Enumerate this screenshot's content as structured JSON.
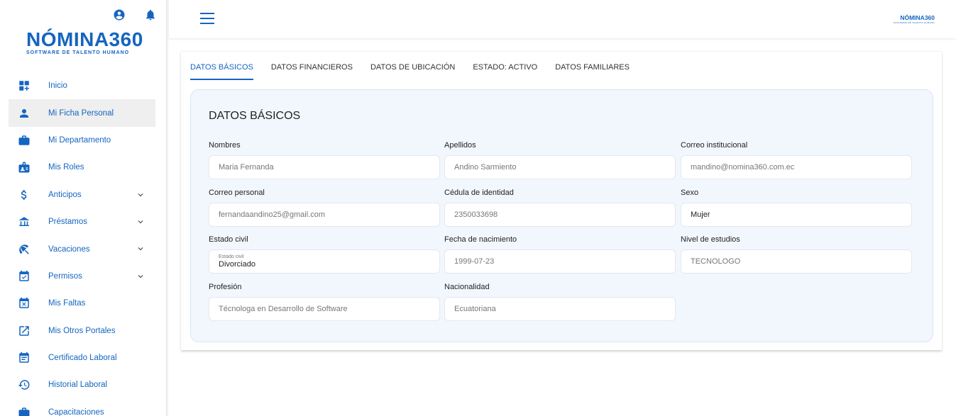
{
  "sidebar": {
    "logo_main": "NÓMINA360",
    "logo_sub": "SOFTWARE DE TALENTO HUMANO",
    "items": [
      {
        "label": "Inicio",
        "icon": "dashboard-icon",
        "expandable": false
      },
      {
        "label": "Mi Ficha Personal",
        "icon": "person-icon",
        "expandable": false,
        "active": true
      },
      {
        "label": "Mi Departamento",
        "icon": "briefcase-icon",
        "expandable": false
      },
      {
        "label": "Mis Roles",
        "icon": "badge-icon",
        "expandable": false
      },
      {
        "label": "Anticipos",
        "icon": "dollar-icon",
        "expandable": true
      },
      {
        "label": "Préstamos",
        "icon": "loan-icon",
        "expandable": true
      },
      {
        "label": "Vacaciones",
        "icon": "beach-icon",
        "expandable": true
      },
      {
        "label": "Permisos",
        "icon": "calendar-check-icon",
        "expandable": true
      },
      {
        "label": "Mis Faltas",
        "icon": "calendar-x-icon",
        "expandable": false
      },
      {
        "label": "Mis Otros Portales",
        "icon": "external-link-icon",
        "expandable": false
      },
      {
        "label": "Certificado Laboral",
        "icon": "calendar-doc-icon",
        "expandable": false
      },
      {
        "label": "Historial Laboral",
        "icon": "history-icon",
        "expandable": false
      },
      {
        "label": "Capacitaciones",
        "icon": "training-icon",
        "expandable": false
      }
    ]
  },
  "header": {
    "brand": "NÓMINA360"
  },
  "tabs": [
    {
      "label": "DATOS BÁSICOS",
      "active": true
    },
    {
      "label": "DATOS FINANCIEROS"
    },
    {
      "label": "DATOS DE UBICACIÓN"
    },
    {
      "label": "ESTADO: ACTIVO"
    },
    {
      "label": "DATOS FAMILIARES"
    }
  ],
  "panel": {
    "title": "DATOS BÁSICOS",
    "fields": {
      "nombres": {
        "label": "Nombres",
        "value": "Maria Fernanda"
      },
      "apellidos": {
        "label": "Apellidos",
        "value": "Andino Sarmiento"
      },
      "correo_institucional": {
        "label": "Correo institucional",
        "value": "mandino@nomina360.com.ec"
      },
      "correo_personal": {
        "label": "Correo personal",
        "value": "fernandaandino25@gmail.com"
      },
      "cedula": {
        "label": "Cédula de identidad",
        "value": "2350033698"
      },
      "sexo": {
        "label": "Sexo",
        "value": "Mujer"
      },
      "estado_civil": {
        "label": "Estado civil",
        "select_label": "Estado civil",
        "value": "Divorciado"
      },
      "fecha_nacimiento": {
        "label": "Fecha de nacimiento",
        "value": "1999-07-23"
      },
      "nivel_estudios": {
        "label": "Nivel de estudios",
        "value": "TECNOLOGO"
      },
      "profesion": {
        "label": "Profesión",
        "value": "Técnologa en Desarrollo de Software"
      },
      "nacionalidad": {
        "label": "Nacionalidad",
        "value": "Ecuatoriana"
      }
    }
  },
  "colors": {
    "accent": "#1565c0",
    "panel_bg": "#f2f7fd"
  }
}
